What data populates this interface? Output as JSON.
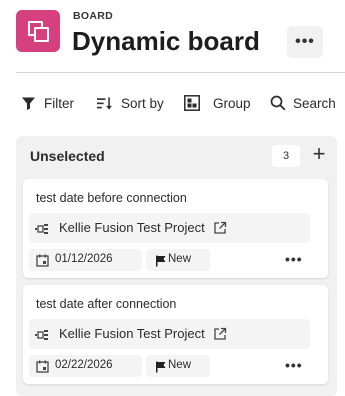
{
  "header": {
    "eyebrow": "BOARD",
    "title": "Dynamic board",
    "more_label": "•••"
  },
  "toolbar": {
    "filter": "Filter",
    "sort": "Sort by",
    "group": "Group",
    "search": "Search"
  },
  "column": {
    "title": "Unselected",
    "count": "3",
    "add_label": "+",
    "cards": [
      {
        "title": "test date before connection",
        "project": "Kellie Fusion Test Project",
        "date": "01/12/2026",
        "status": "New",
        "more": "•••"
      },
      {
        "title": "test date after connection",
        "project": "Kellie Fusion Test Project",
        "date": "02/22/2026",
        "status": "New",
        "more": "•••"
      }
    ]
  },
  "colors": {
    "brand": "#d6407f",
    "column_bg": "#f1f1f1",
    "chip_bg": "#f4f4f4"
  }
}
